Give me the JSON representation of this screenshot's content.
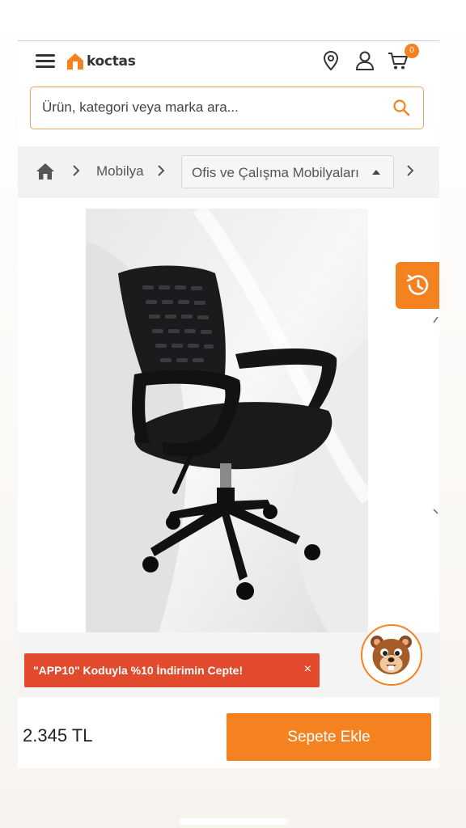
{
  "header": {
    "brand": "koctas",
    "cart_count": "0"
  },
  "search": {
    "placeholder": "Ürün, kategori veya marka ara..."
  },
  "breadcrumb": {
    "category": "Mobilya",
    "subcategory": "Ofis ve Çalışma Mobilyaları"
  },
  "promo": {
    "text": "\"APP10\" Koduyla %10 İndirimin Cepte!",
    "close": "×"
  },
  "product": {
    "price": "2.345 TL",
    "add_to_cart": "Sepete Ekle"
  },
  "colors": {
    "accent": "#f58220",
    "promo": "#e24a2e"
  },
  "icons": [
    "menu-icon",
    "home-logo-icon",
    "location-pin-icon",
    "user-icon",
    "cart-icon",
    "search-icon",
    "home-icon",
    "chevron-right-icon",
    "caret-up-icon",
    "history-icon",
    "beaver-mascot-icon"
  ]
}
